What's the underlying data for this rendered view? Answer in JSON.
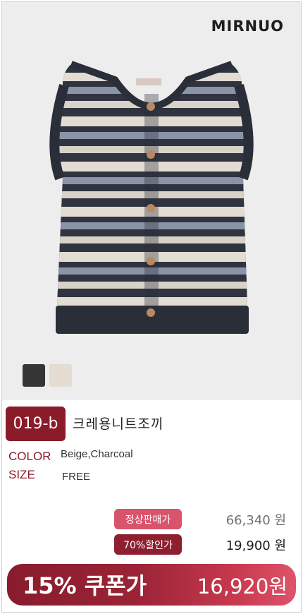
{
  "brand": "MIRNUO",
  "product": {
    "code": "019-b",
    "name": "크레용니트조끼",
    "color_label": "COLOR",
    "color_value": "Beige,Charcoal",
    "size_label": "SIZE",
    "size_value": "FREE",
    "swatches": [
      {
        "name": "Charcoal",
        "color": "#353535"
      },
      {
        "name": "Beige",
        "color": "#e4dbd3"
      }
    ]
  },
  "pricing": {
    "regular_label": "정상판매가",
    "regular_price": "66,340 원",
    "discount_label": "70%할인가",
    "discount_price": "19,900 원",
    "coupon_label": "15% 쿠폰가",
    "coupon_price": "16,920원"
  },
  "colors": {
    "accent": "#8a1c2a",
    "pink": "#d9546a"
  }
}
